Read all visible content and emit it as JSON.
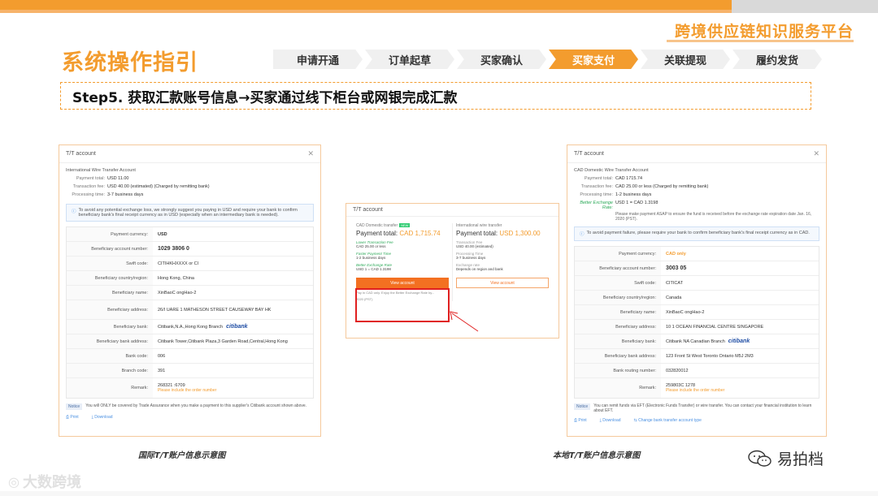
{
  "header": {
    "brand": "跨境供应链知识服务平台",
    "guide_title": "系统操作指引",
    "steps": [
      "申请开通",
      "订单起草",
      "买家确认",
      "买家支付",
      "关联提现",
      "履约发货"
    ],
    "active_step": 3,
    "step5": "Step5. 获取汇款账号信息→买家通过线下柜台或网银完成汇款"
  },
  "left_panel": {
    "title": "T/T account",
    "section": "International Wire Transfer Account",
    "summary": [
      {
        "k": "Payment total:",
        "v": "USD 11.00"
      },
      {
        "k": "Transaction fee:",
        "v": "USD 40.00 (estimated) (Charged by remitting bank)"
      },
      {
        "k": "Processing time:",
        "v": "3-7 business days"
      }
    ],
    "notice": "To avoid any potential exchange loss, we strongly suggest you paying in USD and require your bank to confirm beneficiary bank's final receipt currency as in USD (especially when an intermediary bank is needed).",
    "rows": [
      {
        "k": "Payment currency:",
        "v": "USD"
      },
      {
        "k": "Beneficiary account number:",
        "v": "1029          3806 0"
      },
      {
        "k": "Swift code:",
        "v": "CITIHKHXXXX or CI"
      },
      {
        "k": "Beneficiary country/region:",
        "v": "Hong Kong, China"
      },
      {
        "k": "Beneficiary name:",
        "v": "XinBaoC            ongHao-2"
      },
      {
        "k": "Beneficiary address:",
        "v": "26/I                           UARE 1 MATHESON STREET CAUSEWAY BAY HK"
      },
      {
        "k": "Beneficiary bank:",
        "v": "Citibank,N.A.,Hong Kong Branch"
      },
      {
        "k": "Beneficiary bank address:",
        "v": "Citibank Tower,Citibank Plaza,3 Garden Road,Central,Hong Kong"
      },
      {
        "k": "Bank code:",
        "v": "006"
      },
      {
        "k": "Branch code:",
        "v": "391"
      },
      {
        "k": "Remark:",
        "v": "268321         :6709",
        "note": "Please include the order number"
      }
    ],
    "footer_tag": "Notice",
    "footer": "You will ONLY be covered by Trade Assurance when you make a payment to this supplier's Citibank account shown above.",
    "links": [
      "Print",
      "Download"
    ],
    "bank_logo": "citibank"
  },
  "mid_panel": {
    "title": "T/T account",
    "left": {
      "ttl": "CAD Domestic transfer",
      "badge": "NEW",
      "pay_label": "Payment total:",
      "pay_value": "CAD 1,715.74",
      "items": [
        {
          "lbl": "Lower Transaction Fee",
          "val": "CAD 25.00 or less"
        },
        {
          "lbl": "Faster Payment Time",
          "val": "1-2 business days"
        },
        {
          "lbl": "Better Exchange Rate",
          "val": "USD 1 = CAD 1.3198"
        }
      ],
      "button": "View account",
      "note": "Pay in CAD only. Enjoy the Better Exchange Rate by..."
    },
    "right": {
      "ttl": "International wire transfer",
      "pay_label": "Payment total:",
      "pay_value": "USD 1,300.00",
      "items": [
        {
          "lbl": "Transaction Fee",
          "val": "USD 40.00 (estimated)"
        },
        {
          "lbl": "Processing Time",
          "val": "3-7 business days"
        },
        {
          "lbl": "Exchange rate",
          "val": "Depends on region and bank"
        }
      ],
      "button": "View account"
    },
    "date_note": "2020 (PST)"
  },
  "right_panel": {
    "title": "T/T account",
    "section": "CAD Domestic Wire Transfer Account",
    "summary": [
      {
        "k": "Payment total:",
        "v": "CAD 1715.74"
      },
      {
        "k": "Transaction fee:",
        "v": "CAD 25.00 or less (Charged by remitting bank)"
      },
      {
        "k": "Processing time:",
        "v": "1-2 business days"
      },
      {
        "k": "Better Exchange Rate:",
        "v": "USD 1 = CAD 1.3198"
      }
    ],
    "rate_note": "Please make payment ASAP to ensure the fund is received before the exchange rate expiration date Jan. 16, 2020 (PST).",
    "notice": "To avoid payment failure, please require your bank to confirm beneficiary bank's final receipt currency as in CAD.",
    "rows": [
      {
        "k": "Payment currency:",
        "v": "CAD only"
      },
      {
        "k": "Beneficiary account number:",
        "v": "3003          05"
      },
      {
        "k": "Swift code:",
        "v": "CITICAT"
      },
      {
        "k": "Beneficiary country/region:",
        "v": "Canada"
      },
      {
        "k": "Beneficiary name:",
        "v": "XinBaoC            ongHao-2"
      },
      {
        "k": "Beneficiary address:",
        "v": "10                           1 OCEAN FINANCIAL CENTRE SINGAPORE"
      },
      {
        "k": "Beneficiary bank:",
        "v": "Citibank NA Canadian Branch"
      },
      {
        "k": "Beneficiary bank address:",
        "v": "123 Front St West Toronto Ontario M5J 2M3"
      },
      {
        "k": "Bank routing number:",
        "v": "032820012"
      },
      {
        "k": "Remark:",
        "v": "259803C            1278",
        "note": "Please include the order number"
      }
    ],
    "footer_tag": "Notice",
    "footer": "You can remit funds via EFT (Electronic Funds Transfer) or wire transfer. You can contact your financial institution to learn about EFT.",
    "links": [
      "Print",
      "Download",
      "Change bank transfer account type"
    ],
    "bank_logo": "citibank"
  },
  "captions": {
    "left": "国际T/T账户信息示意图",
    "right": "本地T/T账户信息示意图"
  },
  "watermarks": {
    "left": "大数跨境",
    "right": "易拍档"
  }
}
